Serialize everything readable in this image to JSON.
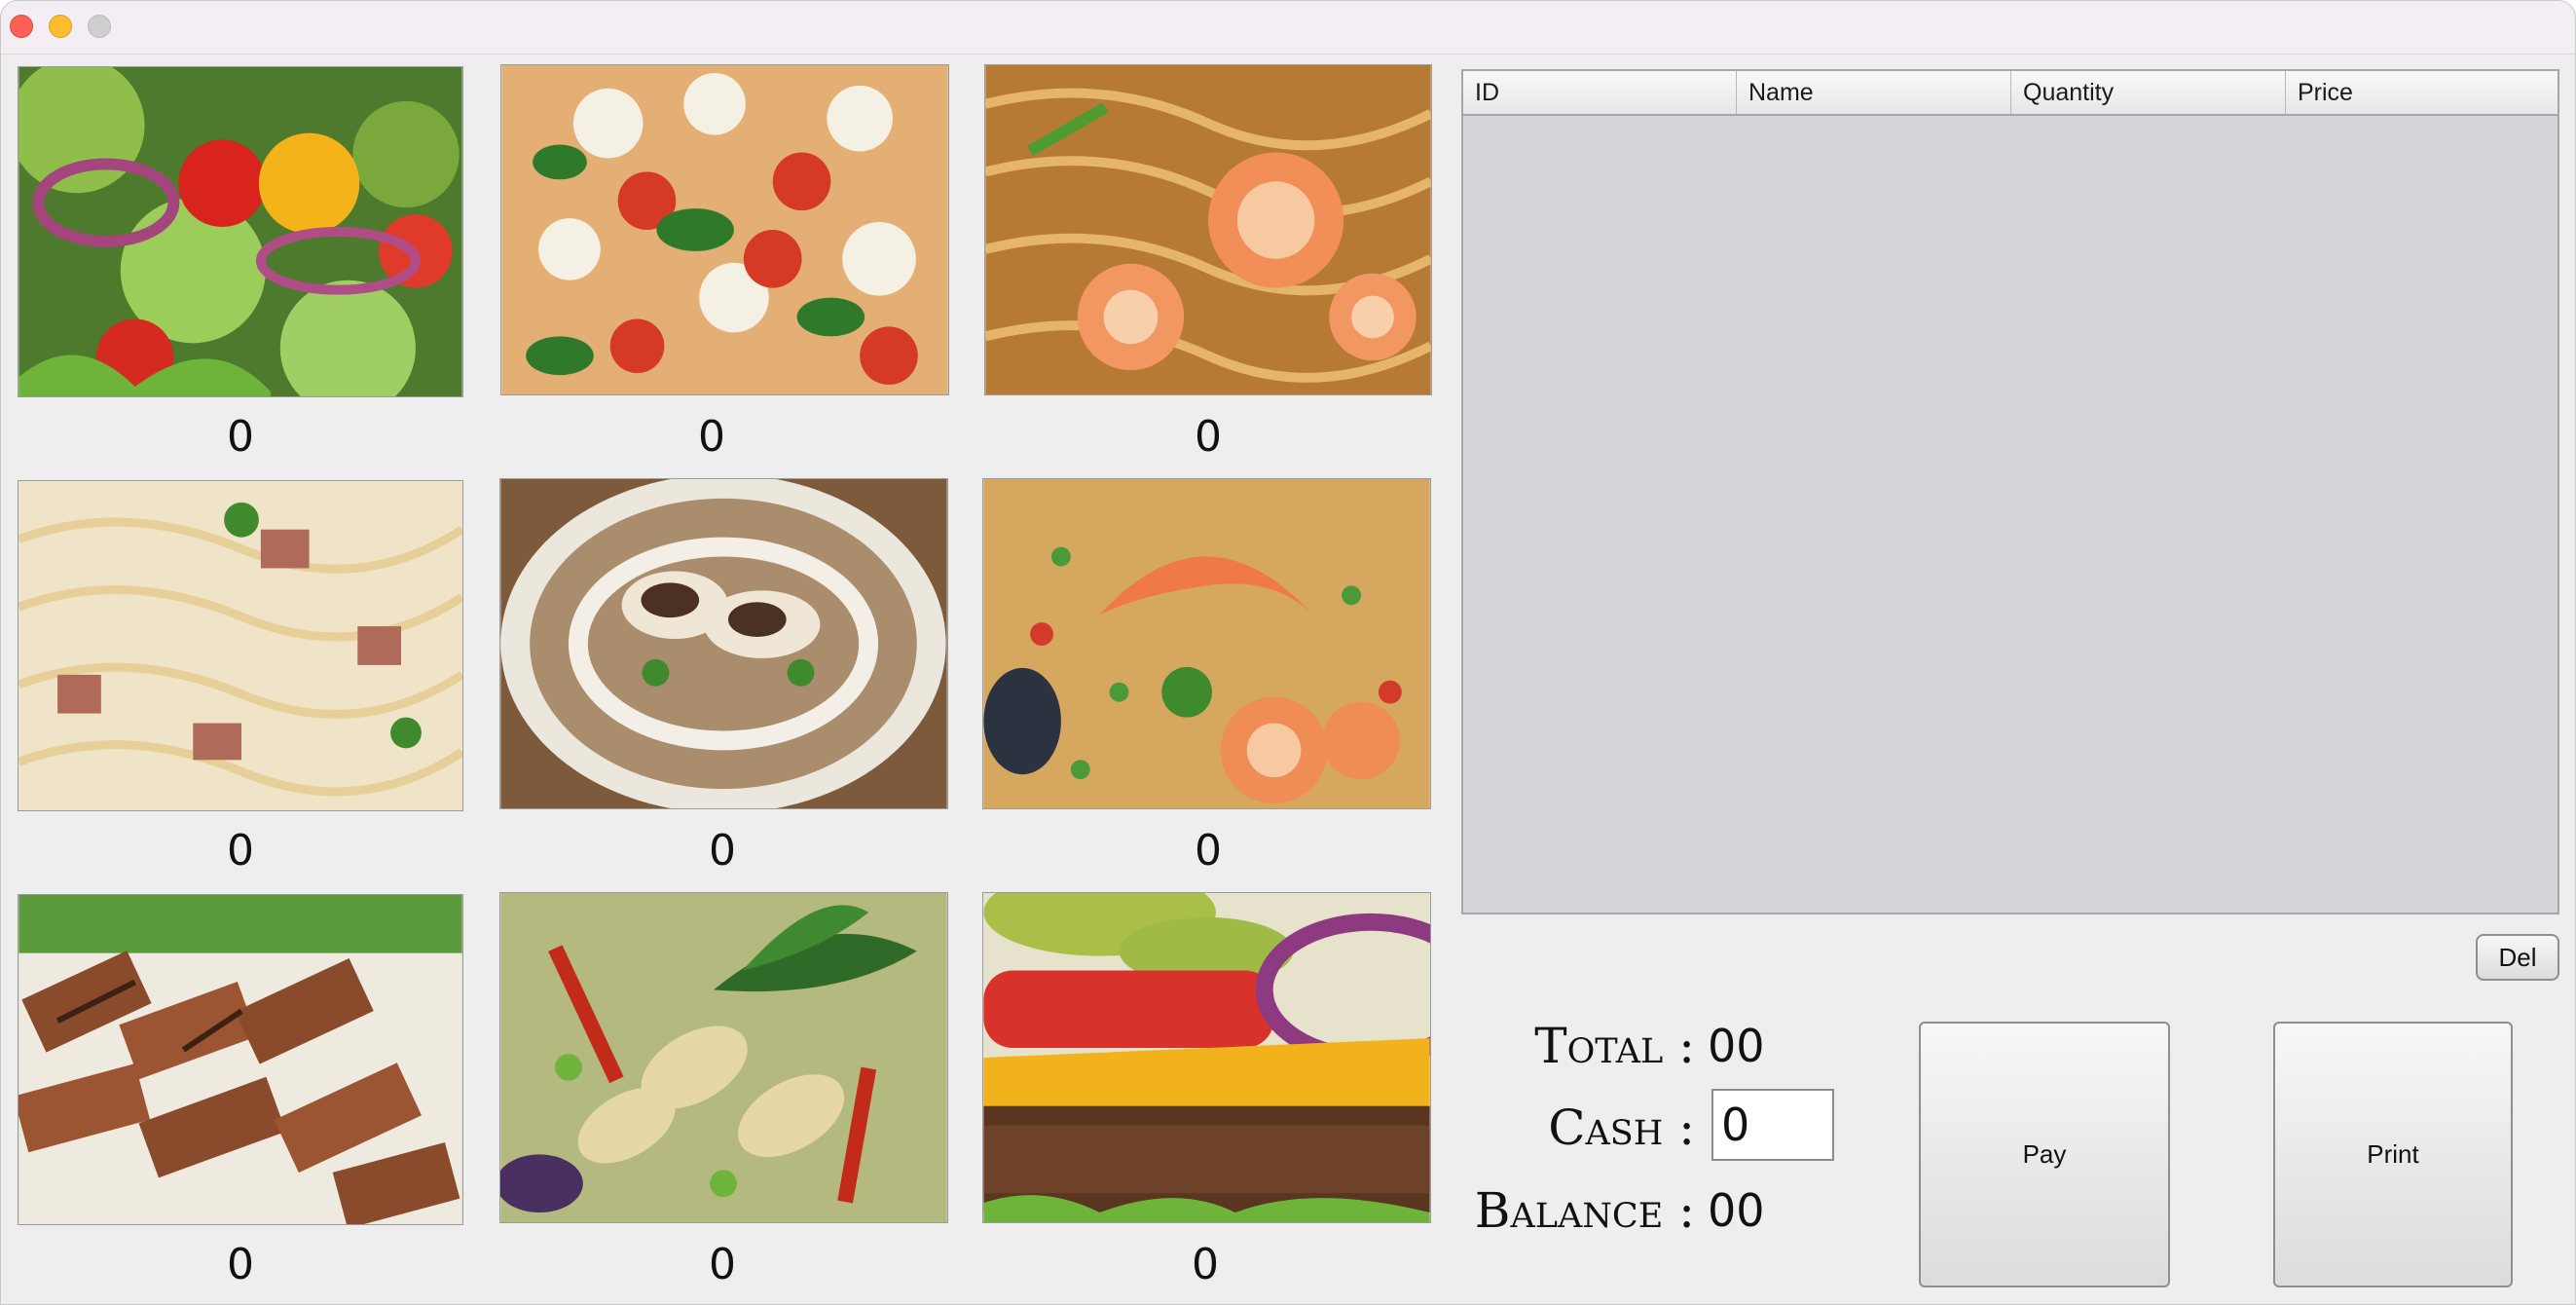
{
  "window": {
    "controls": [
      "close",
      "minimize",
      "maximize"
    ]
  },
  "menu_items": [
    {
      "icon": "salad-image",
      "quantity": "0"
    },
    {
      "icon": "pizza-image",
      "quantity": "0"
    },
    {
      "icon": "shrimp-noodles-image",
      "quantity": "0"
    },
    {
      "icon": "carbonara-image",
      "quantity": "0"
    },
    {
      "icon": "mushroom-soup-image",
      "quantity": "0"
    },
    {
      "icon": "shrimp-fried-rice-image",
      "quantity": "0"
    },
    {
      "icon": "grilled-pork-image",
      "quantity": "0"
    },
    {
      "icon": "green-curry-image",
      "quantity": "0"
    },
    {
      "icon": "cheeseburger-image",
      "quantity": "0"
    }
  ],
  "order_table": {
    "columns": [
      "ID",
      "Name",
      "Quantity",
      "Price"
    ],
    "rows": []
  },
  "actions": {
    "delete_label": "Del",
    "pay_label": "Pay",
    "print_label": "Print"
  },
  "summary": {
    "total_label": "Total :",
    "total_value": "00",
    "cash_label": "Cash :",
    "cash_value": "0",
    "balance_label": "Balance :",
    "balance_value": "00"
  }
}
